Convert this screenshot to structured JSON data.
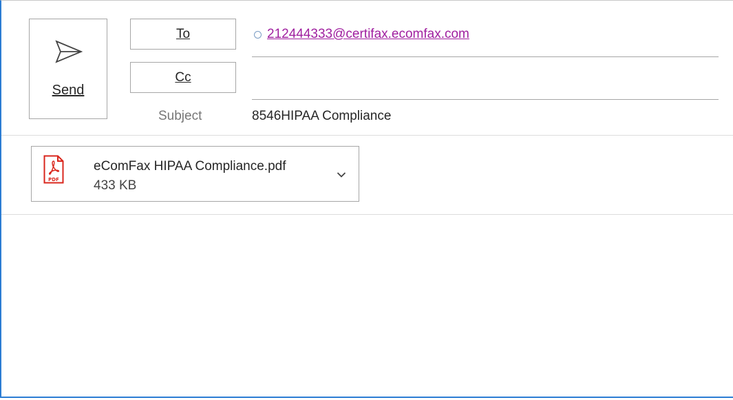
{
  "send": {
    "label": "Send",
    "icon": "send-icon"
  },
  "to": {
    "button_label": "To",
    "recipient": "212444333@certifax.ecomfax.com"
  },
  "cc": {
    "button_label": "Cc",
    "value": ""
  },
  "subject": {
    "label": "Subject",
    "value": "8546HIPAA Compliance"
  },
  "attachment": {
    "name": "eComFax HIPAA Compliance.pdf",
    "size": "433 KB",
    "icon": "pdf-icon",
    "icon_text": "PDF"
  },
  "colors": {
    "accent": "#2b7cd3",
    "link": "#a020a0",
    "pdf_red": "#d9261c"
  }
}
